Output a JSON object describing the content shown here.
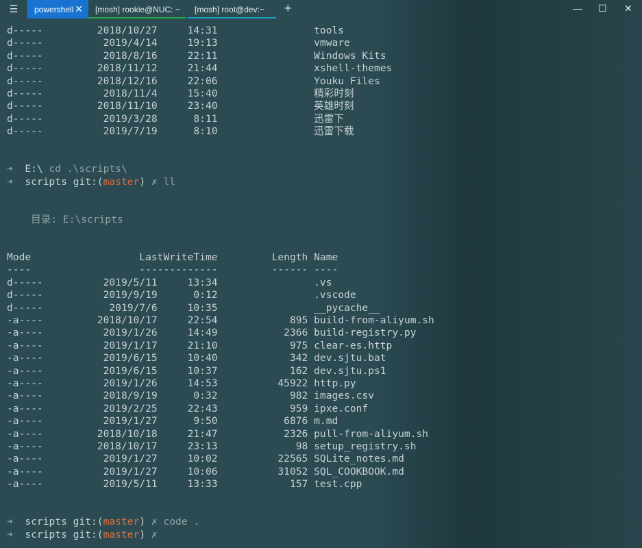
{
  "window": {
    "menu_icon": "hamburger-menu-icon",
    "tabs": [
      {
        "label": "powershell",
        "active": true,
        "accent": "#1874d0"
      },
      {
        "label": "[mosh] rookie@NUC: ~",
        "active": false,
        "accent": "#27a348"
      },
      {
        "label": "[mosh] root@dev:~",
        "active": false,
        "accent": "#1aa3c4"
      }
    ],
    "close_tab_glyph": "✕",
    "new_tab_glyph": "+",
    "minimize_glyph": "—",
    "maximize_glyph": "☐",
    "close_glyph": "✕"
  },
  "terminal": {
    "top_listing": [
      {
        "mode": "d-----",
        "date": "2018/10/27",
        "time": "14:31",
        "length": "",
        "name": "tools"
      },
      {
        "mode": "d-----",
        "date": "2019/4/14",
        "time": "19:13",
        "length": "",
        "name": "vmware"
      },
      {
        "mode": "d-----",
        "date": "2018/8/16",
        "time": "22:11",
        "length": "",
        "name": "Windows Kits"
      },
      {
        "mode": "d-----",
        "date": "2018/11/12",
        "time": "21:44",
        "length": "",
        "name": "xshell-themes"
      },
      {
        "mode": "d-----",
        "date": "2018/12/16",
        "time": "22:06",
        "length": "",
        "name": "Youku Files"
      },
      {
        "mode": "d-----",
        "date": "2018/11/4",
        "time": "15:40",
        "length": "",
        "name": "精彩时刻"
      },
      {
        "mode": "d-----",
        "date": "2018/11/10",
        "time": "23:40",
        "length": "",
        "name": "英雄时刻"
      },
      {
        "mode": "d-----",
        "date": "2019/3/28",
        "time": "8:11",
        "length": "",
        "name": "迅雷下"
      },
      {
        "mode": "d-----",
        "date": "2019/7/19",
        "time": "8:10",
        "length": "",
        "name": "迅雷下载"
      }
    ],
    "prompt1": {
      "arrow": "➜",
      "cwd": "E:\\",
      "command": "cd .\\scripts\\"
    },
    "prompt2": {
      "arrow": "➜",
      "cwd": "scripts",
      "git_prefix": "git:(",
      "branch": "master",
      "git_suffix": ")",
      "dirty": "✗",
      "command": "ll"
    },
    "dir_header": "目录: E:\\scripts",
    "columns": {
      "mode": "Mode",
      "lastwrite": "LastWriteTime",
      "length": "Length",
      "name": "Name"
    },
    "underlines": {
      "mode": "----",
      "lastwrite": "-------------",
      "length": "------",
      "name": "----"
    },
    "listing": [
      {
        "mode": "d-----",
        "date": "2019/5/11",
        "time": "13:34",
        "length": "",
        "name": ".vs"
      },
      {
        "mode": "d-----",
        "date": "2019/9/19",
        "time": "0:12",
        "length": "",
        "name": ".vscode"
      },
      {
        "mode": "d-----",
        "date": "2019/7/6",
        "time": "10:35",
        "length": "",
        "name": "__pycache__"
      },
      {
        "mode": "-a----",
        "date": "2018/10/17",
        "time": "22:54",
        "length": "895",
        "name": "build-from-aliyum.sh"
      },
      {
        "mode": "-a----",
        "date": "2019/1/26",
        "time": "14:49",
        "length": "2366",
        "name": "build-registry.py"
      },
      {
        "mode": "-a----",
        "date": "2019/1/17",
        "time": "21:10",
        "length": "975",
        "name": "clear-es.http"
      },
      {
        "mode": "-a----",
        "date": "2019/6/15",
        "time": "10:40",
        "length": "342",
        "name": "dev.sjtu.bat"
      },
      {
        "mode": "-a----",
        "date": "2019/6/15",
        "time": "10:37",
        "length": "162",
        "name": "dev.sjtu.ps1"
      },
      {
        "mode": "-a----",
        "date": "2019/1/26",
        "time": "14:53",
        "length": "45922",
        "name": "http.py"
      },
      {
        "mode": "-a----",
        "date": "2018/9/19",
        "time": "0:32",
        "length": "982",
        "name": "images.csv"
      },
      {
        "mode": "-a----",
        "date": "2019/2/25",
        "time": "22:43",
        "length": "959",
        "name": "ipxe.conf"
      },
      {
        "mode": "-a----",
        "date": "2019/1/27",
        "time": "9:50",
        "length": "6876",
        "name": "m.md"
      },
      {
        "mode": "-a----",
        "date": "2018/10/18",
        "time": "21:47",
        "length": "2326",
        "name": "pull-from-aliyum.sh"
      },
      {
        "mode": "-a----",
        "date": "2018/10/17",
        "time": "23:13",
        "length": "98",
        "name": "setup_registry.sh"
      },
      {
        "mode": "-a----",
        "date": "2019/1/27",
        "time": "10:02",
        "length": "22565",
        "name": "SQLite_notes.md"
      },
      {
        "mode": "-a----",
        "date": "2019/1/27",
        "time": "10:06",
        "length": "31052",
        "name": "SQL_COOKBOOK.md"
      },
      {
        "mode": "-a----",
        "date": "2019/5/11",
        "time": "13:33",
        "length": "157",
        "name": "test.cpp"
      }
    ],
    "prompt3": {
      "arrow": "➜",
      "cwd": "scripts",
      "git_prefix": "git:(",
      "branch": "master",
      "git_suffix": ")",
      "dirty": "✗",
      "command": "code ."
    },
    "prompt4": {
      "arrow": "➜",
      "cwd": "scripts",
      "git_prefix": "git:(",
      "branch": "master",
      "git_suffix": ")",
      "dirty": "✗",
      "command": ""
    }
  }
}
